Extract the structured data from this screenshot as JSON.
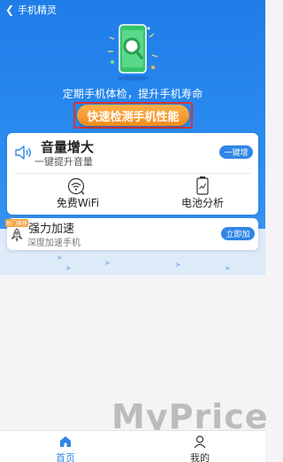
{
  "title_bar": {
    "title": "手机精灵",
    "back_icon": "back-arrow-icon"
  },
  "hero": {
    "slogan": "定期手机体检，提升手机寿命",
    "check_button": "快速检测手机性能",
    "colors": {
      "background": "#2a8cf0",
      "button": "#f08a1c",
      "highlight_outline": "#d9333a"
    }
  },
  "volume_card": {
    "icon": "speaker-icon",
    "title": "音量增大",
    "subtitle": "一键提升音量",
    "action": "一键增"
  },
  "tools": [
    {
      "icon": "wifi-icon",
      "label": "免费WiFi"
    },
    {
      "icon": "battery-icon",
      "label": "电池分析"
    }
  ],
  "speed_card": {
    "badge": "热门推荐",
    "icon": "rocket-icon",
    "title": "强力加速",
    "subtitle": "深度加速手机",
    "action": "立即加"
  },
  "bottom_nav": [
    {
      "icon": "home-icon",
      "label": "首页",
      "active": true
    },
    {
      "icon": "user-icon",
      "label": "我的",
      "active": false
    }
  ],
  "watermark": {
    "text": "MyPrice",
    "url": "myprice.com.cn"
  }
}
